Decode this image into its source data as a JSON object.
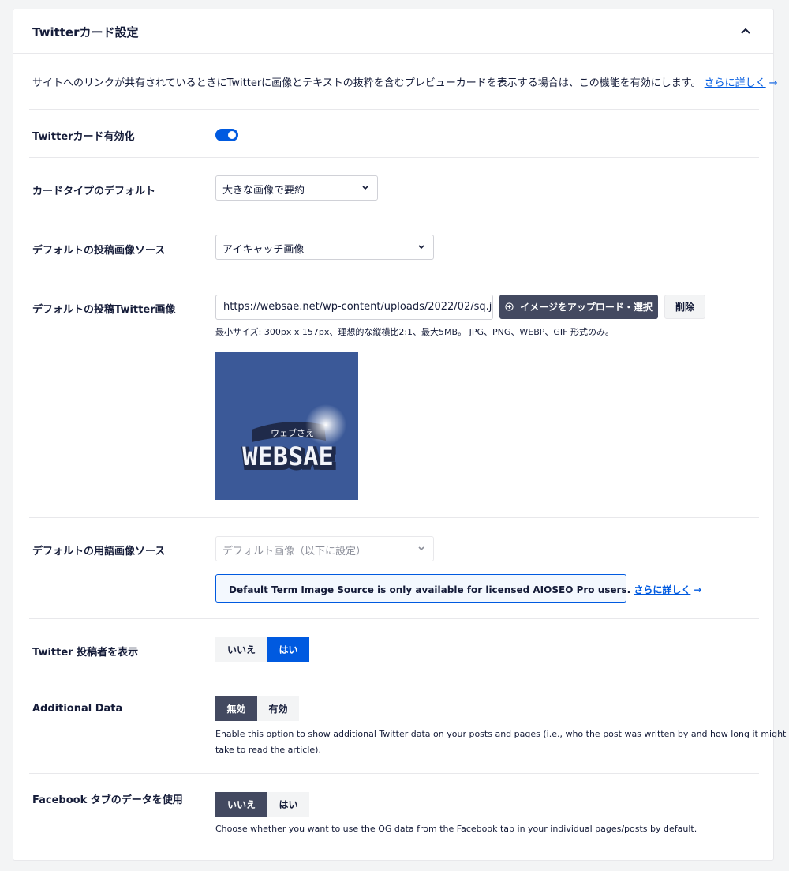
{
  "panel": {
    "title": "Twitterカード設定",
    "description": "サイトへのリンクが共有されているときにTwitterに画像とテキストの抜粋を含むプレビューカードを表示する場合は、この機能を有効にします。",
    "learn_more": "さらに詳しく"
  },
  "settings": {
    "enable_card": {
      "label": "Twitterカード有効化",
      "enabled": true
    },
    "card_type": {
      "label": "カードタイプのデフォルト",
      "value": "大きな画像で要約"
    },
    "post_image_source": {
      "label": "デフォルトの投稿画像ソース",
      "value": "アイキャッチ画像"
    },
    "post_twitter_image": {
      "label": "デフォルトの投稿Twitter画像",
      "url": "https://websae.net/wp-content/uploads/2022/02/sq.jpg",
      "upload_button": "イメージをアップロード・選択",
      "delete_button": "削除",
      "hint": "最小サイズ: 300px x 157px、理想的な縦横比2:1、最大5MB。 JPG、PNG、WEBP、GIF 形式のみ。",
      "preview_kana": "ウェブさえ",
      "preview_logo": "WEBSAE"
    },
    "term_image_source": {
      "label": "デフォルトの用語画像ソース",
      "value": "デフォルト画像（以下に設定）",
      "notice": "Default Term Image Source is only available for licensed AIOSEO Pro users.",
      "notice_link": "さらに詳しく"
    },
    "show_author": {
      "label": "Twitter 投稿者を表示",
      "no": "いいえ",
      "yes": "はい",
      "selected": "yes"
    },
    "additional_data": {
      "label": "Additional Data",
      "off": "無効",
      "on": "有効",
      "selected": "off",
      "help_line1": "Enable this option to show additional Twitter data on your posts and pages (i.e., who the post was written by and how long it might",
      "help_line2": "take to read the article)."
    },
    "use_facebook": {
      "label": "Facebook タブのデータを使用",
      "no": "いいえ",
      "yes": "はい",
      "selected": "no",
      "help": "Choose whether you want to use the OG data from the Facebook tab in your individual pages/posts by default."
    }
  },
  "colors": {
    "accent": "#005ae0",
    "dark": "#434960",
    "preview_bg": "#3b5998"
  }
}
